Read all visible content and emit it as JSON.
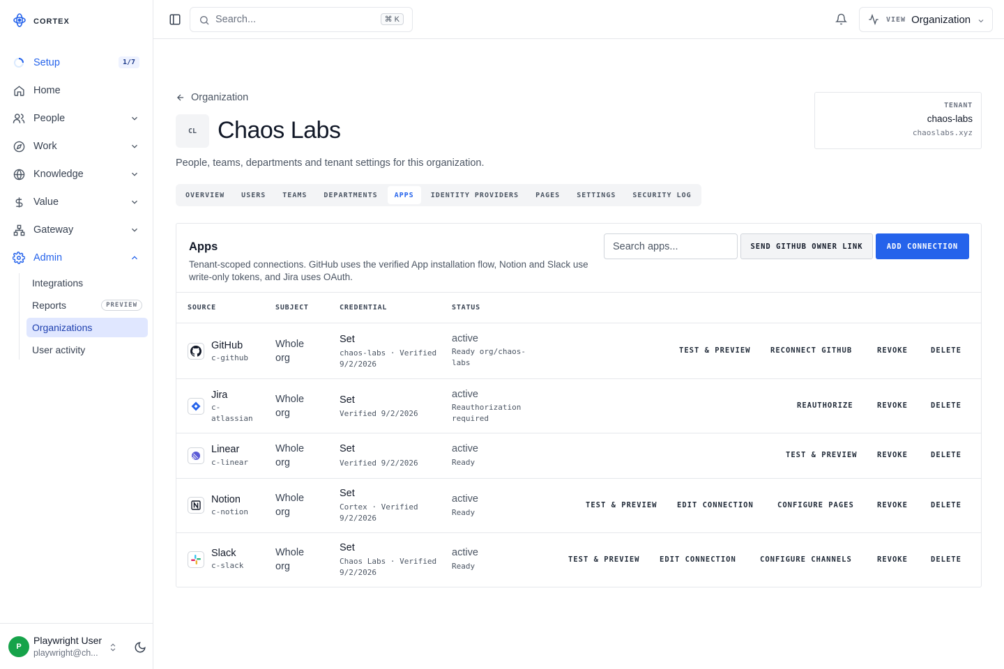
{
  "brand": {
    "name": "CORTEX"
  },
  "sidebar": {
    "setup": {
      "label": "Setup",
      "badge": "1/7"
    },
    "items": [
      {
        "label": "Home"
      },
      {
        "label": "People"
      },
      {
        "label": "Work"
      },
      {
        "label": "Knowledge"
      },
      {
        "label": "Value"
      },
      {
        "label": "Gateway"
      },
      {
        "label": "Admin"
      }
    ],
    "admin_sub": [
      {
        "label": "Integrations"
      },
      {
        "label": "Reports",
        "badge": "PREVIEW"
      },
      {
        "label": "Organizations"
      },
      {
        "label": "User activity"
      }
    ],
    "user": {
      "initial": "P",
      "name": "Playwright User",
      "email": "playwright@ch..."
    }
  },
  "topbar": {
    "search_placeholder": "Search...",
    "shortcut": "⌘ K",
    "view_label": "VIEW",
    "view_value": "Organization"
  },
  "header": {
    "back_label": "Organization",
    "badge": "CL",
    "title": "Chaos Labs",
    "description": "People, teams, departments and tenant settings for this organization."
  },
  "tenant": {
    "label": "TENANT",
    "slug": "chaos-labs",
    "domain": "chaoslabs.xyz"
  },
  "tabs": [
    "OVERVIEW",
    "USERS",
    "TEAMS",
    "DEPARTMENTS",
    "APPS",
    "IDENTITY PROVIDERS",
    "PAGES",
    "SETTINGS",
    "SECURITY LOG"
  ],
  "active_tab": "APPS",
  "apps": {
    "title": "Apps",
    "description": "Tenant-scoped connections. GitHub uses the verified App installation flow, Notion and Slack use write-only tokens, and Jira uses OAuth.",
    "search_placeholder": "Search apps...",
    "owner_button": "SEND GITHUB OWNER LINK",
    "add_button": "ADD CONNECTION",
    "columns": [
      "SOURCE",
      "SUBJECT",
      "CREDENTIAL",
      "STATUS"
    ],
    "rows": [
      {
        "name": "GitHub",
        "id": "c-github",
        "subject": "Whole org",
        "credential": "Set",
        "credential_note": "chaos-labs · Verified 9/2/2026",
        "status": "active",
        "status_note": "Ready org/chaos-labs",
        "actions": [
          "TEST & PREVIEW",
          "RECONNECT GITHUB",
          "REVOKE",
          "DELETE"
        ]
      },
      {
        "name": "Jira",
        "id": "c-atlassian",
        "subject": "Whole org",
        "credential": "Set",
        "credential_note": "Verified 9/2/2026",
        "status": "active",
        "status_note": "Reauthorization required",
        "actions": [
          "REAUTHORIZE",
          "REVOKE",
          "DELETE"
        ]
      },
      {
        "name": "Linear",
        "id": "c-linear",
        "subject": "Whole org",
        "credential": "Set",
        "credential_note": "Verified 9/2/2026",
        "status": "active",
        "status_note": "Ready",
        "actions": [
          "TEST & PREVIEW",
          "REVOKE",
          "DELETE"
        ]
      },
      {
        "name": "Notion",
        "id": "c-notion",
        "subject": "Whole org",
        "credential": "Set",
        "credential_note": "Cortex · Verified 9/2/2026",
        "status": "active",
        "status_note": "Ready",
        "actions": [
          "TEST & PREVIEW",
          "EDIT CONNECTION",
          "CONFIGURE PAGES",
          "REVOKE",
          "DELETE"
        ]
      },
      {
        "name": "Slack",
        "id": "c-slack",
        "subject": "Whole org",
        "credential": "Set",
        "credential_note": "Chaos Labs · Verified 9/2/2026",
        "status": "active",
        "status_note": "Ready",
        "actions": [
          "TEST & PREVIEW",
          "EDIT CONNECTION",
          "CONFIGURE CHANNELS",
          "REVOKE",
          "DELETE"
        ]
      }
    ]
  },
  "colors": {
    "accent": "#2563eb",
    "success": "#16a34a"
  }
}
